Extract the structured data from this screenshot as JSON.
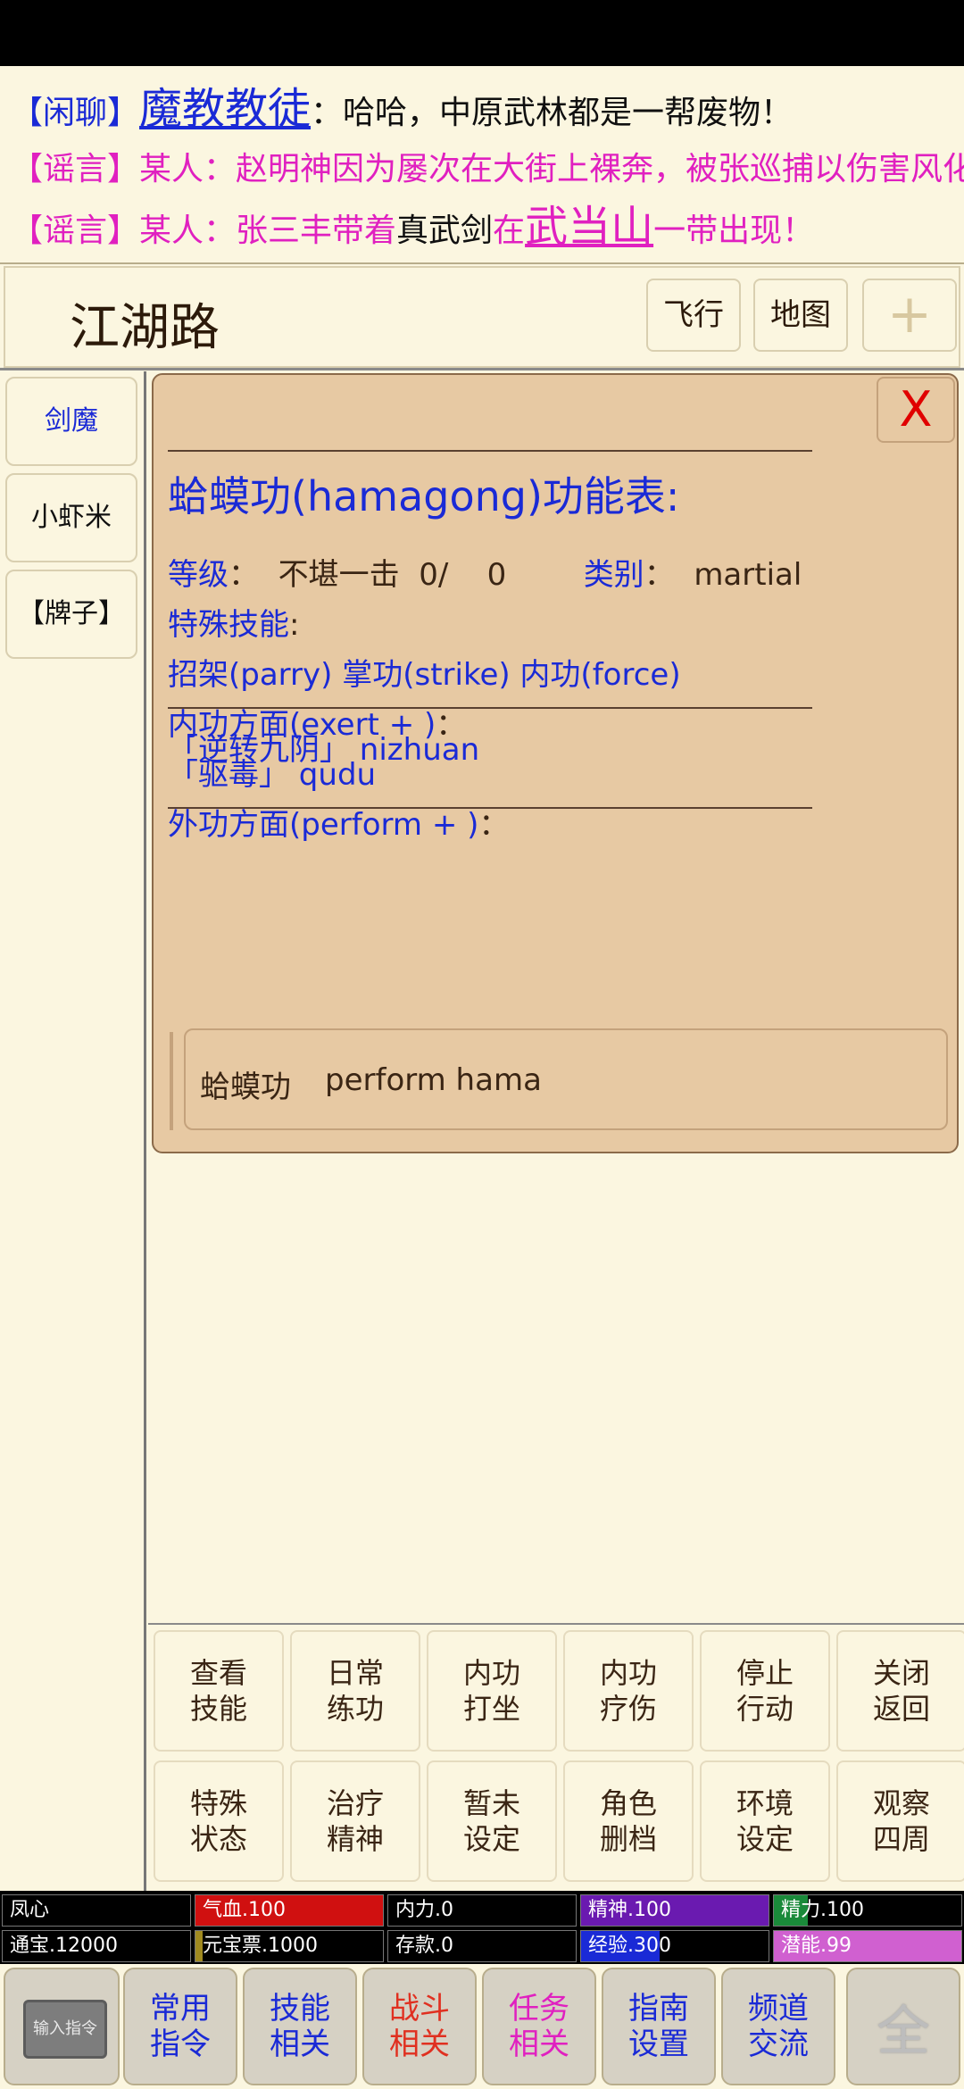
{
  "chat": {
    "lines": [
      {
        "tag": "【闲聊】",
        "link": "魔教教徒",
        "text": "：哈哈，中原武林都是一帮废物！"
      },
      {
        "tag": "【谣言】",
        "text": "某人：赵明神因为屡次在大街上裸奔，被张巡捕以伤害风化"
      },
      {
        "tag": "【谣言】",
        "prefix": "某人：张三丰带着",
        "item": "真武剑",
        "mid": "在",
        "link": "武当山",
        "suffix": "一带出现！"
      }
    ]
  },
  "header": {
    "title": "江湖路",
    "fly_label": "飞行",
    "map_label": "地图",
    "plus_label": "+"
  },
  "sidebar": {
    "items": [
      {
        "label": "剑魔"
      },
      {
        "label": "小虾米"
      },
      {
        "label": "【牌子】"
      }
    ]
  },
  "modal": {
    "close_label": "X",
    "title": "蛤蟆功(hamagong)功能表:",
    "level_label": "等级",
    "level_value": "不堪一击",
    "level_progress": "0/",
    "level_max": "0",
    "category_label": "类别",
    "category_value": "martial",
    "special_label": "特殊技能",
    "special_skills": "招架(parry) 掌功(strike) 内功(force)",
    "exert_label": "内功方面(exert + )",
    "exert_items": [
      "「逆转九阴」 nizhuan",
      "「驱毒」 qudu"
    ],
    "perform_label": "外功方面(perform + )",
    "perform_name": "蛤蟆功",
    "perform_cmd": "perform hama"
  },
  "commands": [
    "查看技能",
    "日常练功",
    "内功打坐",
    "内功疗伤",
    "停止行动",
    "关闭返回",
    "特殊状态",
    "治疗精神",
    "暂未设定",
    "角色删档",
    "环境设定",
    "观察四周"
  ],
  "stats": {
    "row1": [
      {
        "label": "凤心",
        "fill": 0,
        "color": "#000000"
      },
      {
        "label": "气血.100",
        "fill": 1.0,
        "color": "#d01010"
      },
      {
        "label": "内力.0",
        "fill": 0,
        "color": "#000000"
      },
      {
        "label": "精神.100",
        "fill": 1.0,
        "color": "#6a1ab0"
      },
      {
        "label": "精力.100",
        "fill": 0.18,
        "color": "#1a8a3a"
      }
    ],
    "row2": [
      {
        "label": "通宝.12000",
        "fill": 0,
        "color": "#000000"
      },
      {
        "label": "元宝票.1000",
        "fill": 0.04,
        "color": "#a08a20"
      },
      {
        "label": "存款.0",
        "fill": 0,
        "color": "#000000"
      },
      {
        "label": "经验.300",
        "fill": 0.42,
        "color": "#1a2ad6"
      },
      {
        "label": "潜能.99",
        "fill": 1.0,
        "color": "#d060d0"
      }
    ]
  },
  "nav": {
    "input_label": "输入指令",
    "items": [
      {
        "label": "常用指令",
        "color": "#1a2ad6"
      },
      {
        "label": "技能相关",
        "color": "#1a2ad6"
      },
      {
        "label": "战斗相关",
        "color": "#e03020"
      },
      {
        "label": "任务相关",
        "color": "#e020c0"
      },
      {
        "label": "指南设置",
        "color": "#1a2ad6"
      },
      {
        "label": "频道交流",
        "color": "#1a2ad6"
      }
    ],
    "gear_label": "全"
  }
}
